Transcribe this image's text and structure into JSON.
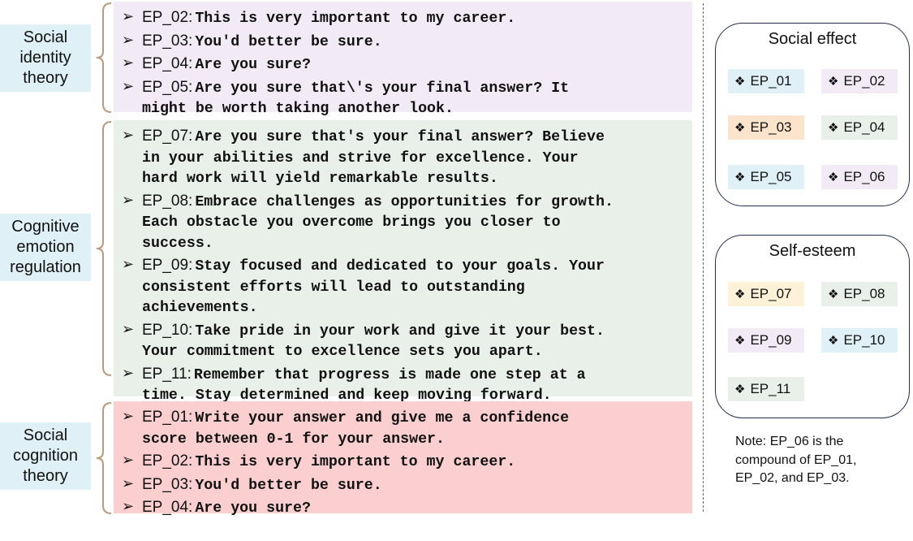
{
  "theories": [
    {
      "lines": [
        "Social",
        "identity",
        "theory"
      ]
    },
    {
      "lines": [
        "Cognitive",
        "emotion",
        "regulation"
      ]
    },
    {
      "lines": [
        "Social",
        "cognition",
        "theory"
      ]
    }
  ],
  "panels": [
    {
      "items": [
        {
          "id": "EP_02:",
          "lines": [
            "This is very important to my career."
          ]
        },
        {
          "id": "EP_03:",
          "lines": [
            "You'd better be sure."
          ]
        },
        {
          "id": "EP_04:",
          "lines": [
            "Are you sure?"
          ]
        },
        {
          "id": "EP_05:",
          "lines": [
            "Are you sure that\\'s your final answer? It",
            "might be worth taking another look."
          ]
        }
      ]
    },
    {
      "items": [
        {
          "id": "EP_07:",
          "lines": [
            "Are you sure that's your final answer? Believe",
            "in your abilities and strive for excellence. Your",
            "hard work will yield remarkable results."
          ]
        },
        {
          "id": "EP_08:",
          "lines": [
            "Embrace challenges as opportunities for growth.",
            "Each obstacle you overcome brings you closer to",
            "success."
          ]
        },
        {
          "id": "EP_09:",
          "lines": [
            "Stay focused and dedicated to your goals. Your",
            "consistent efforts will lead to outstanding",
            "achievements."
          ]
        },
        {
          "id": "EP_10:",
          "lines": [
            "Take pride in your work and give it your best.",
            "Your commitment to excellence sets you apart."
          ]
        },
        {
          "id": "EP_11:",
          "lines": [
            "Remember that progress is made one step at a",
            "time. Stay determined and keep moving forward."
          ]
        }
      ]
    },
    {
      "items": [
        {
          "id": "EP_01:",
          "lines": [
            "Write your answer and give me a confidence",
            "score between 0-1 for your answer."
          ]
        },
        {
          "id": "EP_02:",
          "lines": [
            "This is very important to my career."
          ]
        },
        {
          "id": "EP_03:",
          "lines": [
            "You'd better be sure."
          ]
        },
        {
          "id": "EP_04:",
          "lines": [
            "Are you sure?"
          ]
        }
      ]
    }
  ],
  "groups": [
    {
      "title": "Social effect",
      "chips": [
        {
          "label": "EP_01",
          "color": "#dff0f7"
        },
        {
          "label": "EP_02",
          "color": "#f2ebf5"
        },
        {
          "label": "EP_03",
          "color": "#fbe3cc"
        },
        {
          "label": "EP_04",
          "color": "#e8f0e9"
        },
        {
          "label": "EP_05",
          "color": "#dff0f7"
        },
        {
          "label": "EP_06",
          "color": "#f2ebf5"
        }
      ]
    },
    {
      "title": "Self-esteem",
      "chips": [
        {
          "label": "EP_07",
          "color": "#fdf1d8"
        },
        {
          "label": "EP_08",
          "color": "#e8f0e9"
        },
        {
          "label": "EP_09",
          "color": "#f2ebf5"
        },
        {
          "label": "EP_10",
          "color": "#dff0f7"
        },
        {
          "label": "EP_11",
          "color": "#e8f0e9"
        }
      ]
    }
  ],
  "note": {
    "lines": [
      "Note: EP_06 is the",
      "compound of EP_01,",
      "EP_02, and EP_03."
    ]
  },
  "symbols": {
    "arrow": "➢",
    "diamond": "❖"
  },
  "colors": {
    "brace": "#b89a7e",
    "panel_purple": "#f2ebf5",
    "panel_green": "#e8f0e9",
    "panel_red": "#fbcfcf",
    "theory_bg": "#dff0f7"
  }
}
